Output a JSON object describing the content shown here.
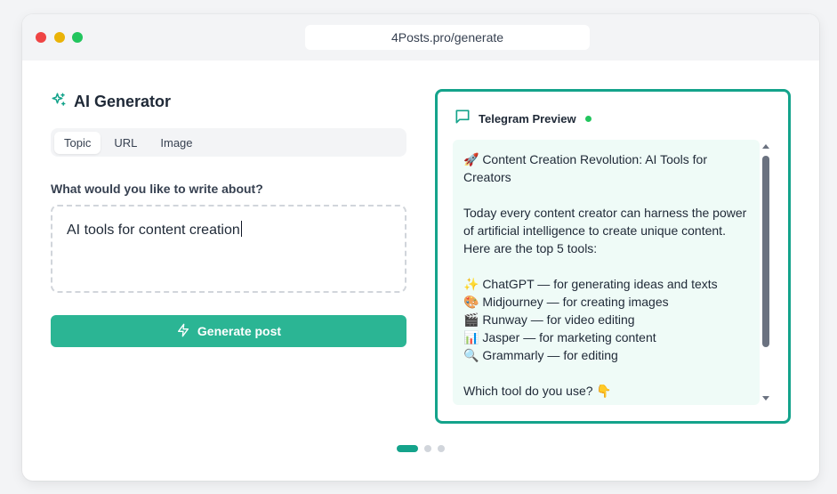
{
  "browser": {
    "url": "4Posts.pro/generate"
  },
  "generator": {
    "title": "AI Generator",
    "tabs": [
      {
        "label": "Topic",
        "active": true
      },
      {
        "label": "URL",
        "active": false
      },
      {
        "label": "Image",
        "active": false
      }
    ],
    "prompt_label": "What would you like to write about?",
    "prompt_value": "AI tools for content creation",
    "generate_label": "Generate post"
  },
  "preview": {
    "title": "Telegram Preview",
    "status": "online",
    "lines": [
      "🚀 Content Creation Revolution: AI Tools for Creators",
      "Today every content creator can harness the power of artificial intelligence to create unique content. Here are the top 5 tools:",
      "✨ ChatGPT — for generating ideas and texts",
      "🎨 Midjourney — for creating images",
      "🎬 Runway — for video editing",
      "📊 Jasper — for marketing content",
      "🔍 Grammarly — for editing",
      "Which tool do you use? 👇"
    ]
  },
  "pager": {
    "count": 3,
    "active_index": 0
  },
  "colors": {
    "accent": "#2bb594",
    "preview_border": "#14a38b",
    "online": "#22c55e"
  },
  "icons": {
    "title": "sparkles-icon",
    "generate": "lightning-icon",
    "preview": "chat-bubble-icon"
  }
}
